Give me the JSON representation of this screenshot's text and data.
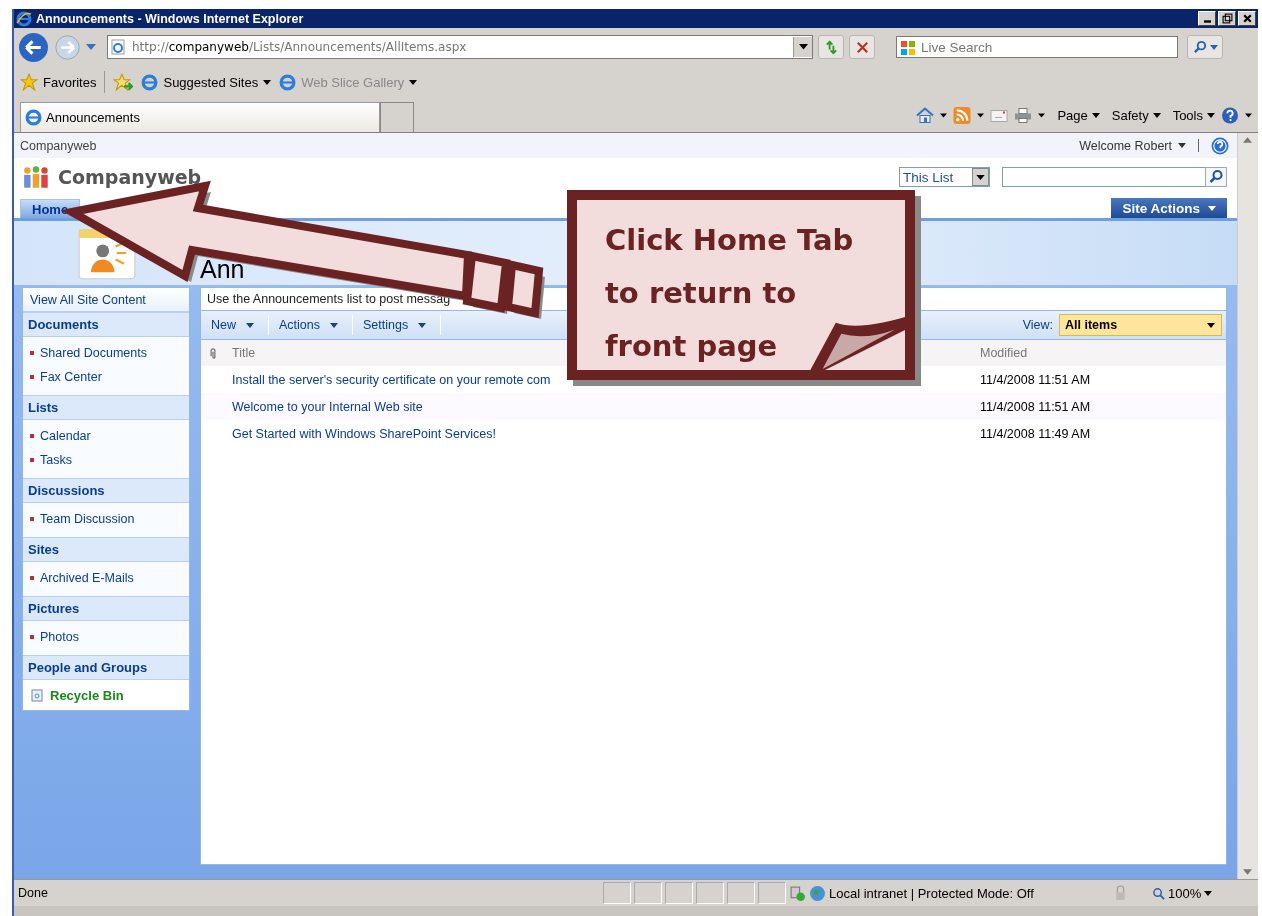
{
  "window": {
    "title": "Announcements - Windows Internet Explorer"
  },
  "address": {
    "scheme": "http://",
    "host": "companyweb",
    "path": "/Lists/Announcements/AllItems.aspx"
  },
  "search": {
    "placeholder": "Live Search"
  },
  "favorites": {
    "label": "Favorites",
    "links": [
      {
        "label": "Suggested Sites",
        "disabled": false
      },
      {
        "label": "Web Slice Gallery",
        "disabled": true
      }
    ]
  },
  "browser_tab": {
    "label": "Announcements"
  },
  "command_bar": [
    "Page",
    "Safety",
    "Tools"
  ],
  "site": {
    "top_link": "Companyweb",
    "welcome": "Welcome Robert",
    "title": "Companyweb",
    "scope": "This List",
    "tabs": [
      {
        "label": "Home",
        "selected": true
      }
    ],
    "site_actions": "Site Actions",
    "page_title": "Ann"
  },
  "nav": {
    "view_all": "View All Site Content",
    "sections": [
      {
        "heading": "Documents",
        "items": [
          "Shared Documents",
          "Fax Center"
        ]
      },
      {
        "heading": "Lists",
        "items": [
          "Calendar",
          "Tasks"
        ]
      },
      {
        "heading": "Discussions",
        "items": [
          "Team Discussion"
        ]
      },
      {
        "heading": "Sites",
        "items": [
          "Archived E-Mails"
        ]
      },
      {
        "heading": "Pictures",
        "items": [
          "Photos"
        ]
      },
      {
        "heading": "People and Groups"
      }
    ],
    "recycle": "Recycle Bin"
  },
  "list": {
    "description": "Use the Announcements list to post messag",
    "toolbar": [
      "New",
      "Actions",
      "Settings"
    ],
    "view_label": "View:",
    "view": "All items",
    "columns": [
      "Title",
      "Modified"
    ],
    "rows": [
      {
        "title": "Install the server's security certificate on your remote com",
        "modified": "11/4/2008 11:51 AM"
      },
      {
        "title": "Welcome to your Internal Web site",
        "modified": "11/4/2008 11:51 AM"
      },
      {
        "title": "Get Started with Windows SharePoint Services!",
        "modified": "11/4/2008 11:49 AM"
      }
    ]
  },
  "callout": {
    "text": "Click Home Tab to return to front page"
  },
  "status_bar": {
    "text": "Done",
    "zone": "Local intranet | Protected Mode: Off",
    "zoom": "100%"
  }
}
